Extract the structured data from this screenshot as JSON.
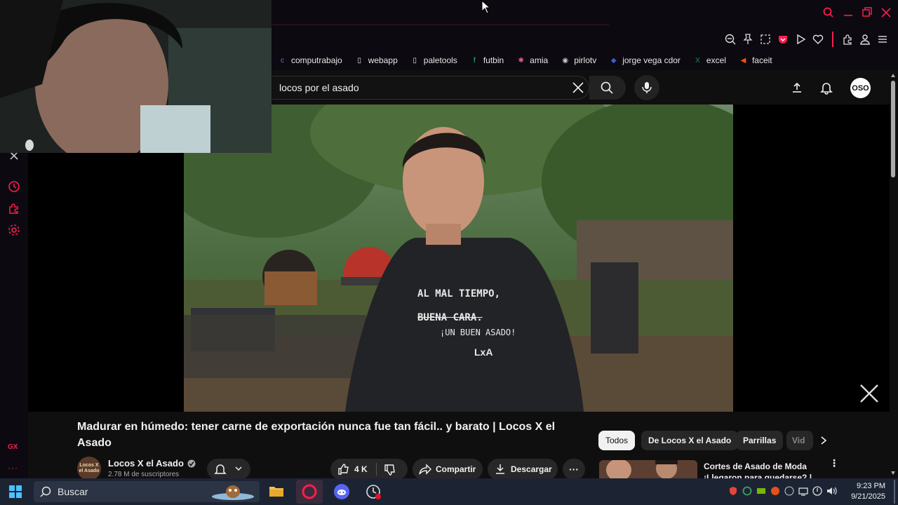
{
  "browser": {
    "bookmarks": [
      {
        "label": "computrabajo",
        "color": "#5b7bd5",
        "glyph": "c"
      },
      {
        "label": "webapp",
        "color": "#e6e6e6",
        "glyph": "▯"
      },
      {
        "label": "paletools",
        "color": "#e6e6e6",
        "glyph": "▯"
      },
      {
        "label": "futbin",
        "color": "#2ecc71",
        "glyph": "f"
      },
      {
        "label": "amia",
        "color": "#e05a8a",
        "glyph": "✱"
      },
      {
        "label": "pirlotv",
        "color": "#cccccc",
        "glyph": "◉"
      },
      {
        "label": "jorge vega cdor",
        "color": "#3b5bdb",
        "glyph": "◆"
      },
      {
        "label": "excel",
        "color": "#1d8a4a",
        "glyph": "X"
      },
      {
        "label": "faceit",
        "color": "#ff5500",
        "glyph": "◀"
      }
    ]
  },
  "youtube": {
    "search_query": "locos por el asado",
    "avatar_text": "OSO",
    "video": {
      "title": "Madurar en húmedo: tener carne de exportación nunca fue tan fácil.. y barato | Locos X el Asado",
      "shirt_line1": "AL MAL TIEMPO,",
      "shirt_line2": "BUENA CARA.",
      "shirt_line3": "¡UN BUEN ASADO!",
      "shirt_logo": "LxA"
    },
    "channel": {
      "name": "Locos X el Asado",
      "subscribers": "2.78 M de suscriptores",
      "avatar_text": "Locos X el Asado"
    },
    "actions": {
      "likes": "4 K",
      "share": "Compartir",
      "download": "Descargar"
    },
    "chips": [
      "Todos",
      "De Locos X el Asado",
      "Parrillas",
      "Vid"
    ],
    "recommended": {
      "title_line1": "Cortes de Asado de Moda",
      "title_line2": "¡Llegaron para quedarse? |"
    }
  },
  "taskbar": {
    "search_placeholder": "Buscar",
    "time": "9:23 PM",
    "date": "9/21/2025"
  },
  "sidebar": {
    "gx_label": "GX"
  },
  "colors": {
    "accent": "#fa1e4e",
    "yt_bg": "#0f0f0f",
    "chip_bg": "#272727",
    "taskbar": "#1c2433"
  }
}
